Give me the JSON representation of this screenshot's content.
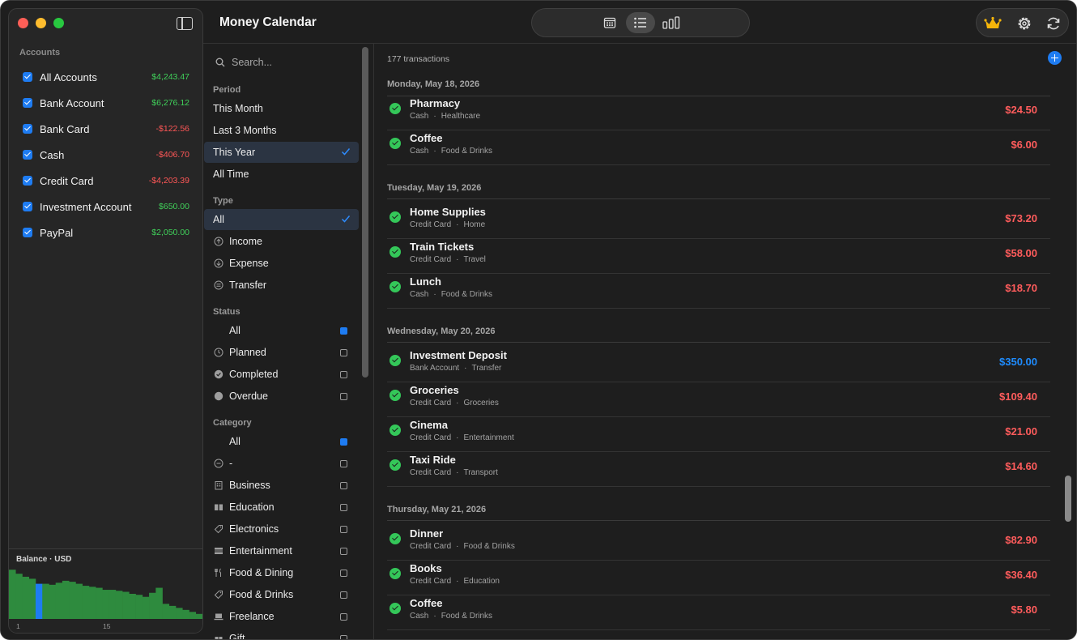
{
  "app": {
    "title": "Money Calendar"
  },
  "sidebar": {
    "heading": "Accounts",
    "accounts": [
      {
        "name": "All Accounts",
        "balance": "$4,243.47",
        "tone": "pos"
      },
      {
        "name": "Bank Account",
        "balance": "$6,276.12",
        "tone": "pos"
      },
      {
        "name": "Bank Card",
        "balance": "-$122.56",
        "tone": "neg"
      },
      {
        "name": "Cash",
        "balance": "-$406.70",
        "tone": "neg"
      },
      {
        "name": "Credit Card",
        "balance": "-$4,203.39",
        "tone": "neg"
      },
      {
        "name": "Investment Account",
        "balance": "$650.00",
        "tone": "pos"
      },
      {
        "name": "PayPal",
        "balance": "$2,050.00",
        "tone": "pos"
      }
    ],
    "balance_chart": {
      "title": "Balance · USD",
      "tick_1": "1",
      "tick_15": "15",
      "bars": [
        0.98,
        0.9,
        0.84,
        0.8,
        0.7,
        0.7,
        0.68,
        0.72,
        0.76,
        0.74,
        0.7,
        0.66,
        0.64,
        0.62,
        0.58,
        0.58,
        0.56,
        0.54,
        0.5,
        0.48,
        0.44,
        0.52,
        0.62,
        0.3,
        0.26,
        0.22,
        0.18,
        0.14,
        0.1
      ],
      "highlight_index": 4,
      "bar_color": "#2e8b3e",
      "highlight_color": "#1e7cf2"
    }
  },
  "toolbar": {
    "views": [
      "calendar-icon",
      "list-icon",
      "chart-bars-icon"
    ],
    "active_view": "list-icon",
    "tools": [
      "crown-icon",
      "gear-icon",
      "refresh-icon"
    ]
  },
  "filters": {
    "search_placeholder": "Search...",
    "period_heading": "Period",
    "period": [
      "This Month",
      "Last 3 Months",
      "This Year",
      "All Time"
    ],
    "period_selected": "This Year",
    "type_heading": "Type",
    "type": [
      "All",
      "Income",
      "Expense",
      "Transfer"
    ],
    "type_selected": "All",
    "status_heading": "Status",
    "status": [
      "All",
      "Planned",
      "Completed",
      "Overdue"
    ],
    "category_heading": "Category",
    "category": [
      "All",
      "-",
      "Business",
      "Education",
      "Electronics",
      "Entertainment",
      "Food & Dining",
      "Food & Drinks",
      "Freelance",
      "Gift"
    ]
  },
  "transactions": {
    "count_label": "177 transactions",
    "groups": [
      {
        "date": "Monday, May 18, 2026",
        "items": [
          {
            "name": "Pharmacy",
            "account": "Cash",
            "category": "Healthcare",
            "amount": "$24.50",
            "kind": "expense"
          },
          {
            "name": "Coffee",
            "account": "Cash",
            "category": "Food & Drinks",
            "amount": "$6.00",
            "kind": "expense"
          }
        ]
      },
      {
        "date": "Tuesday, May 19, 2026",
        "items": [
          {
            "name": "Home Supplies",
            "account": "Credit Card",
            "category": "Home",
            "amount": "$73.20",
            "kind": "expense"
          },
          {
            "name": "Train Tickets",
            "account": "Credit Card",
            "category": "Travel",
            "amount": "$58.00",
            "kind": "expense"
          },
          {
            "name": "Lunch",
            "account": "Cash",
            "category": "Food & Drinks",
            "amount": "$18.70",
            "kind": "expense"
          }
        ]
      },
      {
        "date": "Wednesday, May 20, 2026",
        "items": [
          {
            "name": "Investment Deposit",
            "account": "Bank Account",
            "category": "Transfer",
            "amount": "$350.00",
            "kind": "income"
          },
          {
            "name": "Groceries",
            "account": "Credit Card",
            "category": "Groceries",
            "amount": "$109.40",
            "kind": "expense"
          },
          {
            "name": "Cinema",
            "account": "Credit Card",
            "category": "Entertainment",
            "amount": "$21.00",
            "kind": "expense"
          },
          {
            "name": "Taxi Ride",
            "account": "Credit Card",
            "category": "Transport",
            "amount": "$14.60",
            "kind": "expense"
          }
        ]
      },
      {
        "date": "Thursday, May 21, 2026",
        "items": [
          {
            "name": "Dinner",
            "account": "Credit Card",
            "category": "Food & Drinks",
            "amount": "$82.90",
            "kind": "expense"
          },
          {
            "name": "Books",
            "account": "Credit Card",
            "category": "Education",
            "amount": "$36.40",
            "kind": "expense"
          },
          {
            "name": "Coffee",
            "account": "Cash",
            "category": "Food & Drinks",
            "amount": "$5.80",
            "kind": "expense"
          }
        ]
      }
    ]
  }
}
